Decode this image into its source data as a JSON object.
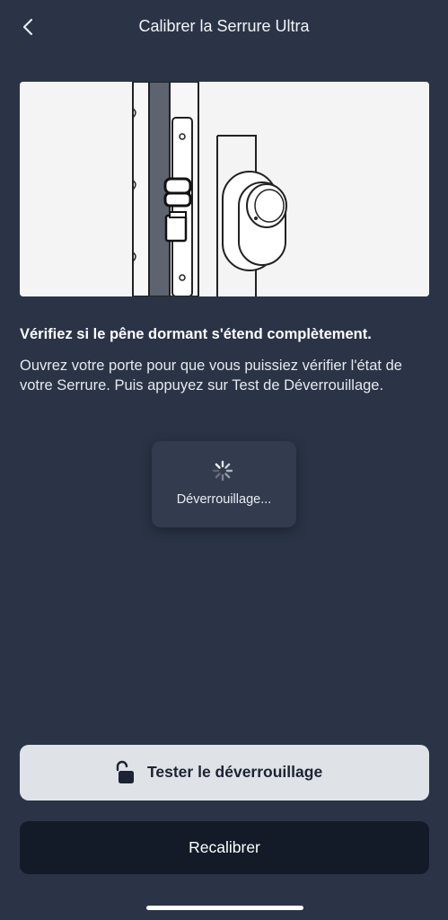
{
  "header": {
    "title": "Calibrer la Serrure Ultra",
    "back_icon": "chevron-left-icon"
  },
  "illustration": {
    "subject": "door-lock-bolt-illustration"
  },
  "instructions": {
    "heading": "Vérifiez si le pêne dormant s'étend complètement.",
    "body": "Ouvrez votre porte pour que vous puissiez vérifier l'état de votre Serrure. Puis appuyez sur Test de Déverrouillage."
  },
  "toast": {
    "label": "Déverrouillage...",
    "icon": "spinner-icon"
  },
  "buttons": {
    "test_label": "Tester le déverrouillage",
    "test_icon": "unlock-icon",
    "recalibrate_label": "Recalibrer"
  },
  "colors": {
    "background": "#2a3446",
    "primary_button": "#dfe2e7",
    "secondary_button": "#141b28"
  }
}
